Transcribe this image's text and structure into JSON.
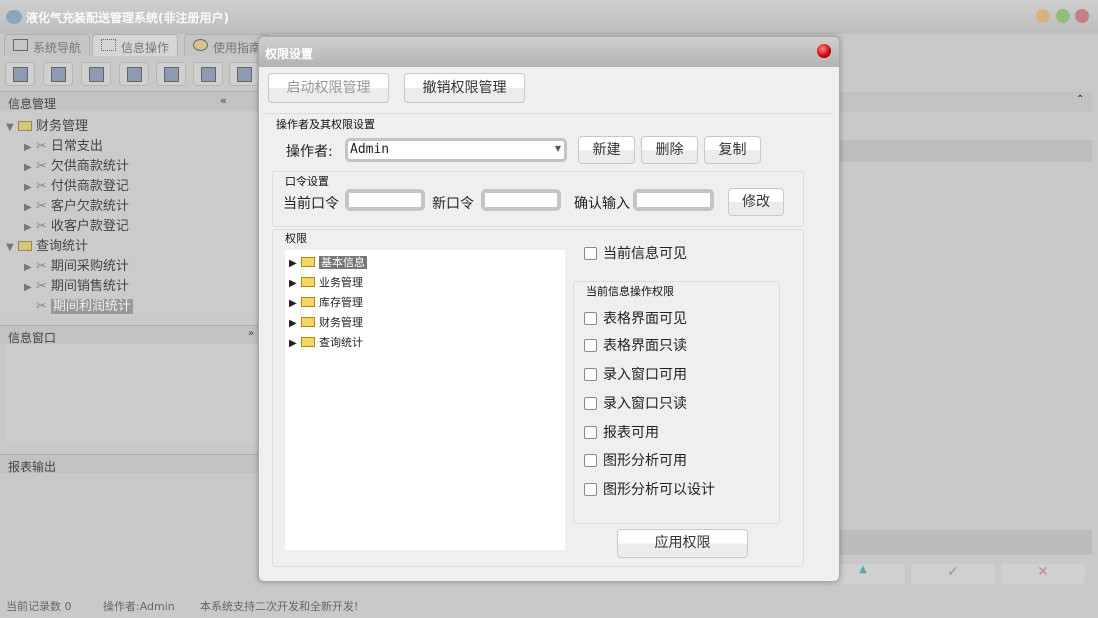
{
  "app": {
    "title": "液化气充装配送管理系统(非注册用户)"
  },
  "tabs": [
    {
      "label": "系统导航"
    },
    {
      "label": "信息操作"
    },
    {
      "label": "使用指南"
    }
  ],
  "left": {
    "info_mgmt": "信息管理",
    "tree": [
      {
        "label": "财务管理",
        "level": 0
      },
      {
        "label": "日常支出",
        "level": 1
      },
      {
        "label": "欠供商款统计",
        "level": 1
      },
      {
        "label": "付供商款登记",
        "level": 1
      },
      {
        "label": "客户欠款统计",
        "level": 1
      },
      {
        "label": "收客户款登记",
        "level": 1
      },
      {
        "label": "查询统计",
        "level": 0
      },
      {
        "label": "期间采购统计",
        "level": 1
      },
      {
        "label": "期间销售统计",
        "level": 1
      },
      {
        "label": "期间利润统计",
        "level": 1
      }
    ],
    "info_window": "信息窗口",
    "report_output": "报表输出"
  },
  "status": {
    "records": "当前记录数 0",
    "operator": "操作者:Admin",
    "note": "本系统支持二次开发和全新开发!"
  },
  "dialog": {
    "title": "权限设置",
    "enable_btn": "启动权限管理",
    "revoke_btn": "撤销权限管理",
    "operator_group": "操作者及其权限设置",
    "operator_label": "操作者:",
    "operator_value": "Admin",
    "new_btn": "新建",
    "delete_btn": "删除",
    "copy_btn": "复制",
    "pwd_group": "口令设置",
    "cur_pwd": "当前口令",
    "new_pwd": "新口令",
    "confirm_pwd": "确认输入",
    "modify_btn": "修改",
    "perm_group": "权限",
    "perm_tree": [
      "基本信息",
      "业务管理",
      "库存管理",
      "财务管理",
      "查询统计"
    ],
    "visible_cb": "当前信息可见",
    "op_group": "当前信息操作权限",
    "op_checks": [
      "表格界面可见",
      "表格界面只读",
      "录入窗口可用",
      "录入窗口只读",
      "报表可用",
      "图形分析可用",
      "图形分析可以设计"
    ],
    "apply_btn": "应用权限"
  }
}
